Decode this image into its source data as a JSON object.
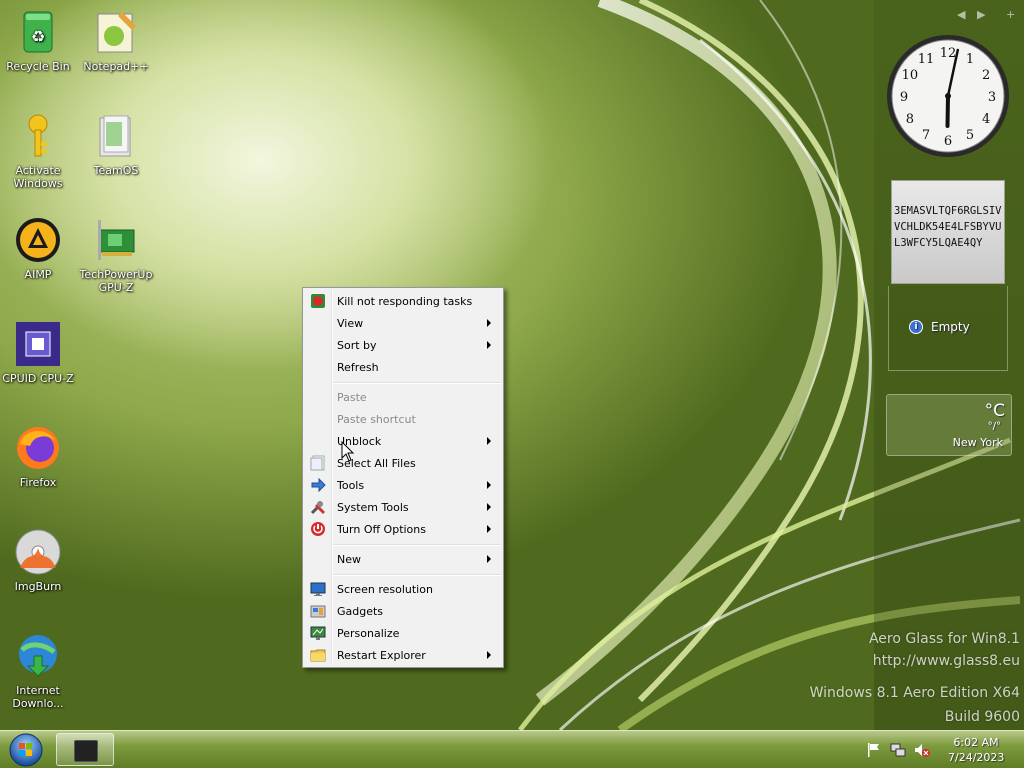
{
  "desktop": {
    "icons": [
      {
        "label": "Recycle Bin",
        "icon": "recycle-bin-icon"
      },
      {
        "label": "Notepad++",
        "icon": "notepad-plus-plus-icon"
      },
      {
        "label": "Activate Windows",
        "icon": "key-icon"
      },
      {
        "label": "TeamOS",
        "icon": "folder-icon"
      },
      {
        "label": "AIMP",
        "icon": "aimp-icon"
      },
      {
        "label": "TechPowerUp GPU-Z",
        "icon": "gpu-z-icon"
      },
      {
        "label": "CPUID CPU-Z",
        "icon": "cpu-z-icon"
      },
      {
        "label": "Firefox",
        "icon": "firefox-icon"
      },
      {
        "label": "ImgBurn",
        "icon": "imgburn-icon"
      },
      {
        "label": "Internet Downlo...",
        "icon": "idm-icon"
      }
    ]
  },
  "sidebar": {
    "controls": [
      "◀",
      "▶",
      "+"
    ],
    "clock": {
      "hour": 6,
      "minute": 2
    },
    "note_text": "3EMASVLTQF6RGLSIVVCHLDK54E4LFSBYVUL3WFCY5LQAE4QY",
    "feed_text": "Empty",
    "weather": {
      "unit": "°C",
      "values": "°/°",
      "city": "New York"
    }
  },
  "watermark": {
    "line1": "Aero Glass for Win8.1",
    "line2": "http://www.glass8.eu",
    "line3": "Windows 8.1 Aero Edition X64",
    "line4": "Build 9600"
  },
  "context_menu": {
    "items": [
      {
        "label": "Kill not responding tasks",
        "icon": "kill-tasks-icon",
        "submenu": false
      },
      {
        "label": "View",
        "submenu": true
      },
      {
        "label": "Sort by",
        "submenu": true
      },
      {
        "label": "Refresh",
        "submenu": false
      },
      {
        "label": "Paste",
        "disabled": true
      },
      {
        "label": "Paste shortcut",
        "disabled": true
      },
      {
        "label": "Unblock",
        "submenu": true
      },
      {
        "label": "Select All Files",
        "icon": "select-all-icon",
        "submenu": false
      },
      {
        "label": "Tools",
        "icon": "tools-icon",
        "submenu": true
      },
      {
        "label": "System Tools",
        "icon": "system-tools-icon",
        "submenu": true
      },
      {
        "label": "Turn Off Options",
        "icon": "power-icon",
        "submenu": true
      },
      {
        "label": "New",
        "submenu": true
      },
      {
        "label": "Screen resolution",
        "icon": "monitor-icon"
      },
      {
        "label": "Gadgets",
        "icon": "gadgets-icon"
      },
      {
        "label": "Personalize",
        "icon": "personalize-icon"
      },
      {
        "label": "Restart Explorer",
        "icon": "restart-explorer-icon",
        "submenu": true
      }
    ]
  },
  "taskbar": {
    "time": "6:02 AM",
    "date": "7/24/2023",
    "colors": {
      "accent": "#7d9a3e"
    }
  }
}
